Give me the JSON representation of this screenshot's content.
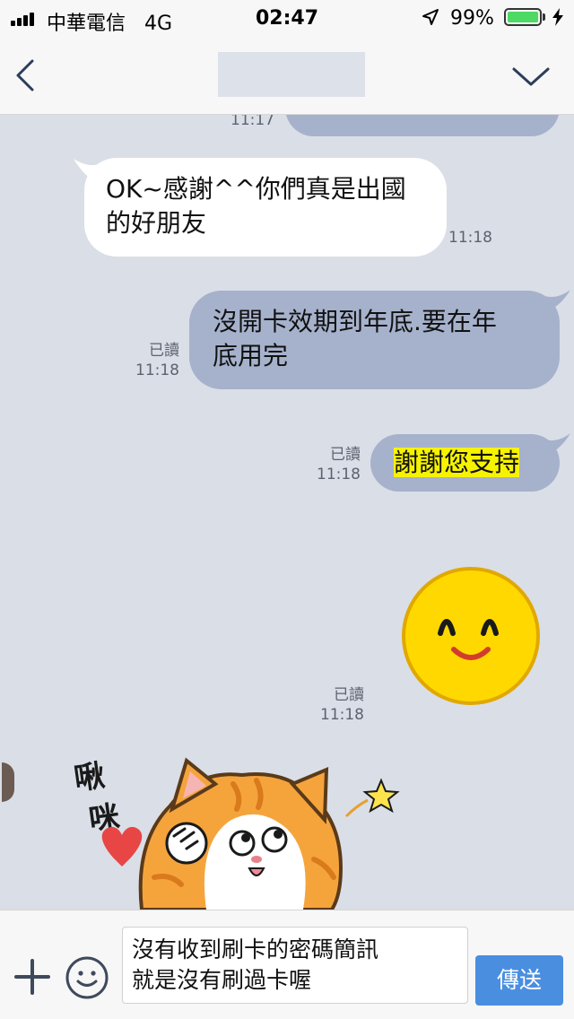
{
  "status_bar": {
    "carrier": "中華電信",
    "network": "4G",
    "time": "02:47",
    "battery_percent": "99%",
    "battery_level": 0.99,
    "battery_color": "#4cd964"
  },
  "header": {
    "title": "",
    "back_icon": "chevron-left-icon",
    "dropdown_icon": "chevron-down-icon"
  },
  "messages": [
    {
      "direction": "incoming",
      "text": "OK~感謝^^你們真是出國的好朋友",
      "line1": "OK~感謝^^你們真是出國",
      "line2": "的好朋友",
      "time": "11:18"
    },
    {
      "direction": "outgoing",
      "text": "沒開卡效期到年底.要在年底用完",
      "line1": "沒開卡效期到年底.要在年",
      "line2": "底用完",
      "read": "已讀",
      "time": "11:18"
    },
    {
      "direction": "outgoing",
      "text": "謝謝您支持",
      "read": "已讀",
      "time": "11:18"
    },
    {
      "direction": "outgoing",
      "type": "sticker",
      "sticker": "smiley-face-sticker",
      "read": "已讀",
      "time": "11:18"
    },
    {
      "direction": "incoming",
      "type": "sticker",
      "sticker": "orange-cat-sticker",
      "sticker_text": [
        "啾",
        "咪"
      ]
    }
  ],
  "partial_top_message": {
    "time": "11:17"
  },
  "input": {
    "value": "沒有收到刷卡的密碼簡訊\n就是沒有刷過卡喔",
    "send_label": "傳送"
  },
  "colors": {
    "chat_background": "#dadee6",
    "outgoing_bubble": "#a6b2cc",
    "incoming_bubble": "#ffffff",
    "highlight": "#f7f300",
    "send_button": "#4a8ee0"
  }
}
